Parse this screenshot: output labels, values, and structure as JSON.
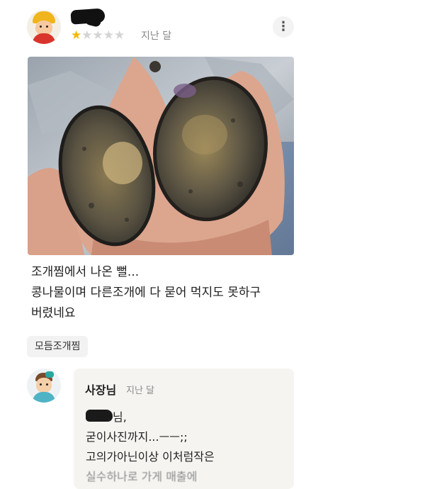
{
  "review": {
    "author_name": "",
    "rating": 1,
    "rating_max": 5,
    "date": "지난 달",
    "lines": [
      "조개찜에서 나온 뻘...",
      "콩나물이며 다른조개에 다 묻어 먹지도 못하구",
      "버렸네요"
    ],
    "menu_tag": "모듬조개찜",
    "more_icon": "kebab-icon"
  },
  "reply": {
    "author": "사장님",
    "date": "지난 달",
    "lines": [
      "님,",
      "굳이사진까지...ㅡㅡ;;",
      "고의가아닌이상  이처럼작은",
      "실수하나로 가게 매출에"
    ]
  },
  "colors": {
    "star_on": "#f5b900",
    "star_off": "#d4d4d4",
    "reply_bg": "#f6f4f1",
    "tag_bg": "#f2f2f2"
  }
}
